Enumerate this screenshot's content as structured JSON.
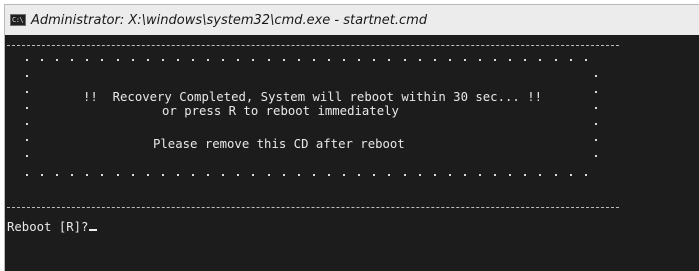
{
  "window": {
    "title": "Administrator: X:\\windows\\system32\\cmd.exe - startnet.cmd",
    "icon": "cmd-console-icon",
    "icon_label": "C:\\"
  },
  "console": {
    "banner": {
      "line1": "!!  Recovery Completed, System will reboot within 30 sec... !!",
      "line2": "or press R to reboot immediately",
      "line3": "Please remove this CD after reboot"
    },
    "prompt": "Reboot [R]?"
  },
  "colors": {
    "console_bg": "#1c1c1c",
    "console_text": "#e8e8e8",
    "titlebar_bg": "#ececec"
  }
}
